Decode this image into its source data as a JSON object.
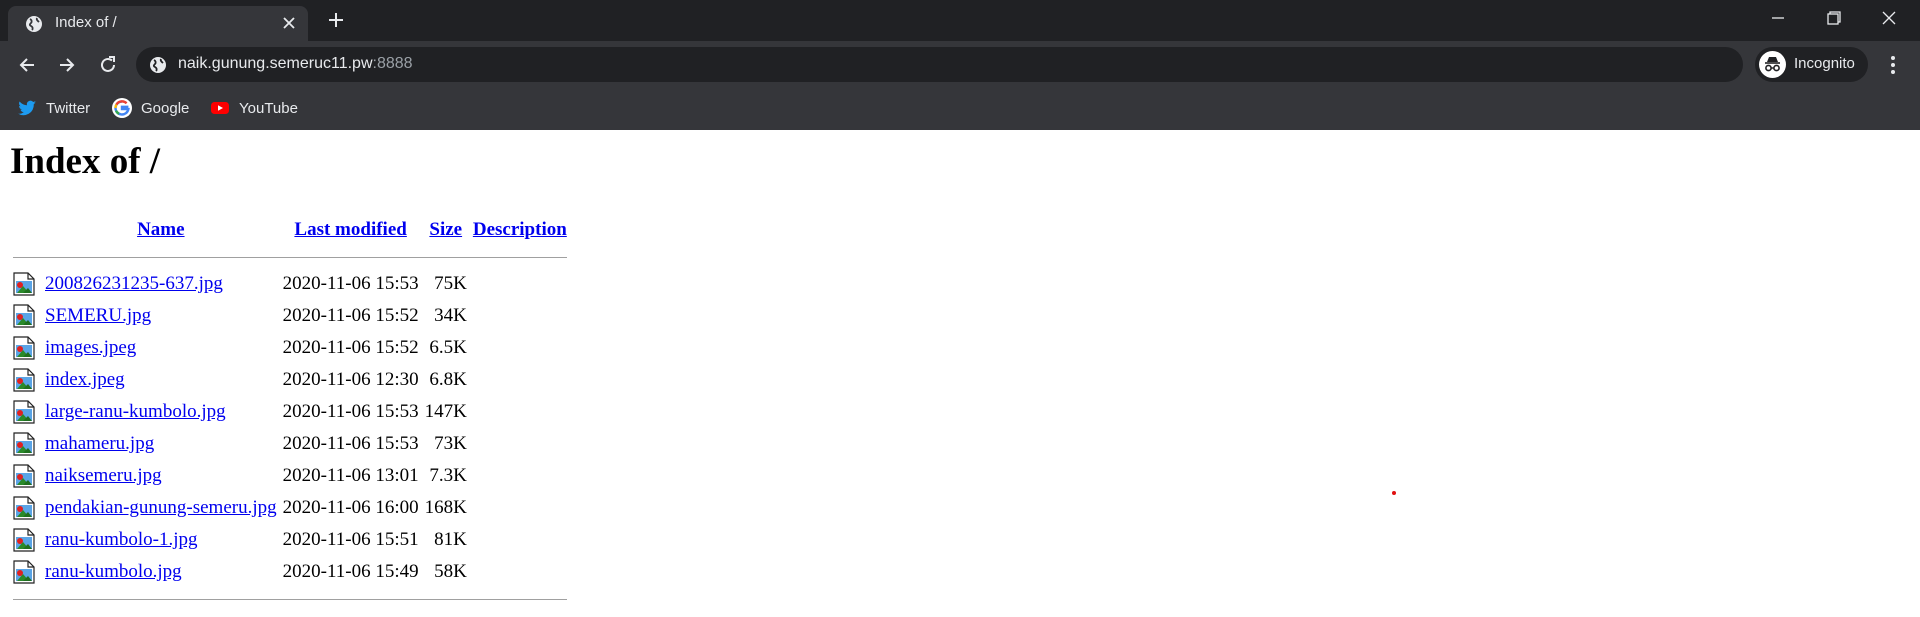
{
  "tab": {
    "title": "Index of /"
  },
  "address_bar": {
    "host": "naik.gunung.semeruc11.pw",
    "port": ":8888"
  },
  "profile": {
    "label": "Incognito"
  },
  "bookmarks": [
    {
      "label": "Twitter",
      "icon": "twitter-icon"
    },
    {
      "label": "Google",
      "icon": "google-icon"
    },
    {
      "label": "YouTube",
      "icon": "youtube-icon"
    }
  ],
  "page": {
    "heading": "Index of /",
    "columns": {
      "name": "Name",
      "last_modified": "Last modified",
      "size": "Size",
      "description": "Description"
    },
    "files": [
      {
        "name": "200826231235-637.jpg",
        "modified": "2020-11-06 15:53",
        "size": "75K"
      },
      {
        "name": "SEMERU.jpg",
        "modified": "2020-11-06 15:52",
        "size": "34K"
      },
      {
        "name": "images.jpeg",
        "modified": "2020-11-06 15:52",
        "size": "6.5K"
      },
      {
        "name": "index.jpeg",
        "modified": "2020-11-06 12:30",
        "size": "6.8K"
      },
      {
        "name": "large-ranu-kumbolo.jpg",
        "modified": "2020-11-06 15:53",
        "size": "147K"
      },
      {
        "name": "mahameru.jpg",
        "modified": "2020-11-06 15:53",
        "size": "73K"
      },
      {
        "name": "naiksemeru.jpg",
        "modified": "2020-11-06 13:01",
        "size": "7.3K"
      },
      {
        "name": "pendakian-gunung-semeru.jpg",
        "modified": "2020-11-06 16:00",
        "size": "168K"
      },
      {
        "name": "ranu-kumbolo-1.jpg",
        "modified": "2020-11-06 15:51",
        "size": "81K"
      },
      {
        "name": "ranu-kumbolo.jpg",
        "modified": "2020-11-06 15:49",
        "size": "58K"
      }
    ]
  },
  "colors": {
    "chrome_dark": "#202124",
    "chrome_toolbar": "#35363a",
    "link": "#0000ee"
  }
}
